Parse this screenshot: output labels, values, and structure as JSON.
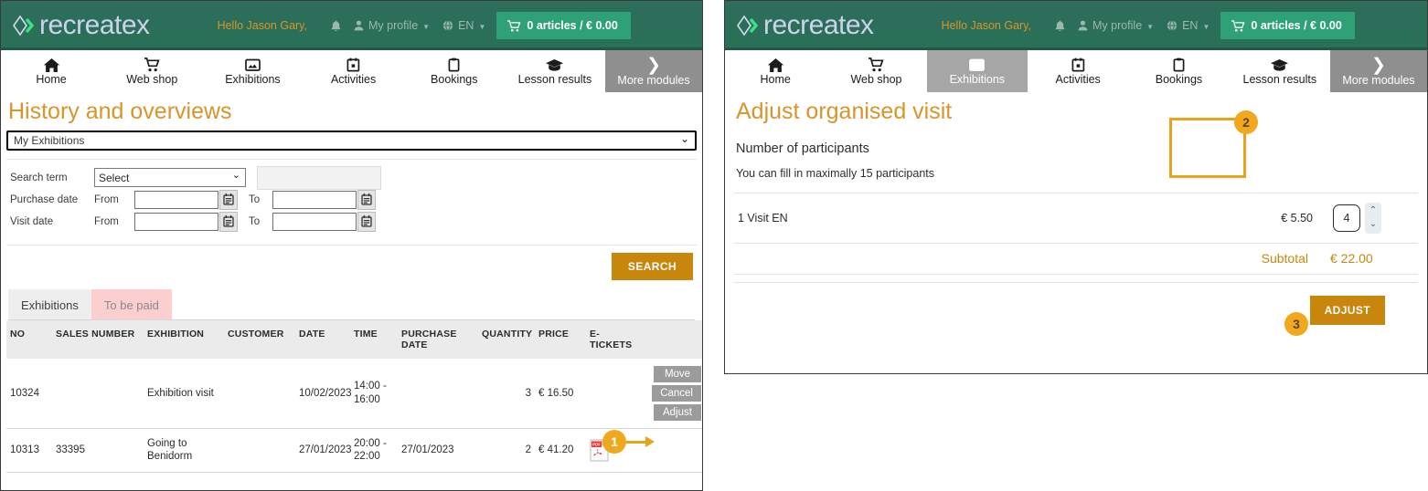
{
  "brand": {
    "name": "recreatex",
    "logo_icon": "diamond-chevron-logo",
    "greeting": "Hello Jason Gary,",
    "bell_icon": "bell-icon",
    "profile_icon": "user-icon",
    "profile_label": "My profile",
    "globe_icon": "globe-icon",
    "language": "EN",
    "cart_icon": "shopping-cart-icon",
    "cart_label": "0 articles / € 0.00",
    "colors": {
      "header_green": "#2b6e59",
      "cart_green": "#2ea176",
      "accent_orange": "#d9942a",
      "callout_orange": "#f0a81e",
      "button_gold": "#c8860d"
    }
  },
  "nav": {
    "items": [
      {
        "label": "Home",
        "icon": "home-icon",
        "active_left": false,
        "active_right": false
      },
      {
        "label": "Web shop",
        "icon": "cart-icon",
        "active_left": false,
        "active_right": false
      },
      {
        "label": "Exhibitions",
        "icon": "picture-icon",
        "active_left": false,
        "active_right": true
      },
      {
        "label": "Activities",
        "icon": "calendar-icon",
        "active_left": false,
        "active_right": false
      },
      {
        "label": "Bookings",
        "icon": "clipboard-icon",
        "active_left": false,
        "active_right": false
      },
      {
        "label": "Lesson results",
        "icon": "graduation-cap-icon",
        "active_left": false,
        "active_right": false
      }
    ],
    "more": {
      "label": "More modules",
      "icon": "chevron-right-icon"
    }
  },
  "left": {
    "title": "History and overviews",
    "overview_select": {
      "value": "My Exhibitions",
      "icon": "chevron-down-icon"
    },
    "form": {
      "search_term_label": "Search term",
      "search_term_select": "Select",
      "search_term_value": "",
      "purchase_date_label": "Purchase date",
      "visit_date_label": "Visit date",
      "from_label": "From",
      "to_label": "To",
      "purchase_from": "",
      "purchase_to": "",
      "visit_from": "",
      "visit_to": "",
      "calendar_icon": "calendar-icon"
    },
    "search_button": "SEARCH",
    "tabs": [
      {
        "label": "Exhibitions",
        "state": "selected"
      },
      {
        "label": "To be paid",
        "state": "warning"
      }
    ],
    "table": {
      "headers": [
        "NO",
        "SALES NUMBER",
        "EXHIBITION",
        "CUSTOMER",
        "DATE",
        "TIME",
        "PURCHASE DATE",
        "QUANTITY",
        "PRICE",
        "E-TICKETS"
      ],
      "rows": [
        {
          "no": "10324",
          "sales_number": "",
          "exhibition": "Exhibition visit",
          "customer": "",
          "date": "10/02/2023",
          "time_start": "14:00 -",
          "time_end": "16:00",
          "purchase_date": "",
          "quantity": "3",
          "price": "€ 16.50",
          "eticket": "",
          "actions": [
            "Move",
            "Cancel",
            "Adjust"
          ]
        },
        {
          "no": "10313",
          "sales_number": "33395",
          "exhibition_line1": "Going to",
          "exhibition_line2": "Benidorm",
          "customer": "",
          "date": "27/01/2023",
          "time_start": "20:00 -",
          "time_end": "22:00",
          "purchase_date": "27/01/2023",
          "quantity": "2",
          "price": "€ 41.20",
          "eticket": "pdf-icon",
          "actions": []
        }
      ]
    },
    "callouts": [
      {
        "number": "1",
        "target": "adjust-button"
      }
    ]
  },
  "right": {
    "title": "Adjust organised visit",
    "subtitle": "Number of participants",
    "note": "You can fill in maximally 15 participants",
    "line_item": {
      "name": "1 Visit EN",
      "price": "€ 5.50",
      "quantity": "4",
      "stepper_up_icon": "chevron-up-icon",
      "stepper_down_icon": "chevron-down-icon"
    },
    "subtotal_label": "Subtotal",
    "subtotal_value": "€ 22.00",
    "adjust_button": "ADJUST",
    "callouts": [
      {
        "number": "2",
        "target": "quantity-stepper"
      },
      {
        "number": "3",
        "target": "adjust-submit-button"
      }
    ]
  }
}
